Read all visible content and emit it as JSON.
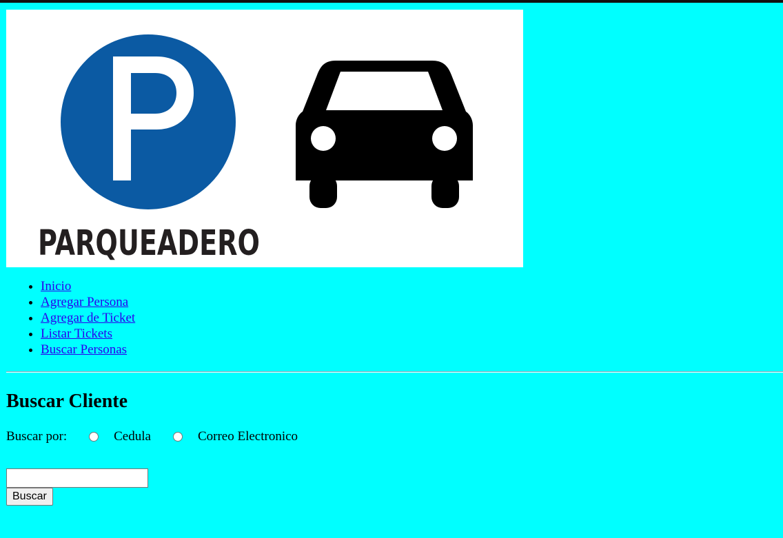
{
  "logo": {
    "parking_letter": "P",
    "text": "PARQUEADERO",
    "icons": [
      "parking-sign-icon",
      "car-icon"
    ],
    "colors": {
      "parking_blue": "#0b5aa3",
      "background": "#ffffff",
      "text": "#231f20"
    }
  },
  "nav": {
    "items": [
      {
        "label": "Inicio"
      },
      {
        "label": "Agregar Persona"
      },
      {
        "label": "Agregar de Ticket"
      },
      {
        "label": "Listar Tickets"
      },
      {
        "label": "Buscar Personas"
      }
    ]
  },
  "main": {
    "title": "Buscar Cliente",
    "search_by_label": "Buscar por:",
    "options": [
      {
        "label": "Cedula",
        "checked": false
      },
      {
        "label": "Correo Electronico",
        "checked": false
      }
    ],
    "search_value": "",
    "search_button_label": "Buscar"
  },
  "theme": {
    "page_background": "#00ffff",
    "link_color": "#2a00ee"
  }
}
